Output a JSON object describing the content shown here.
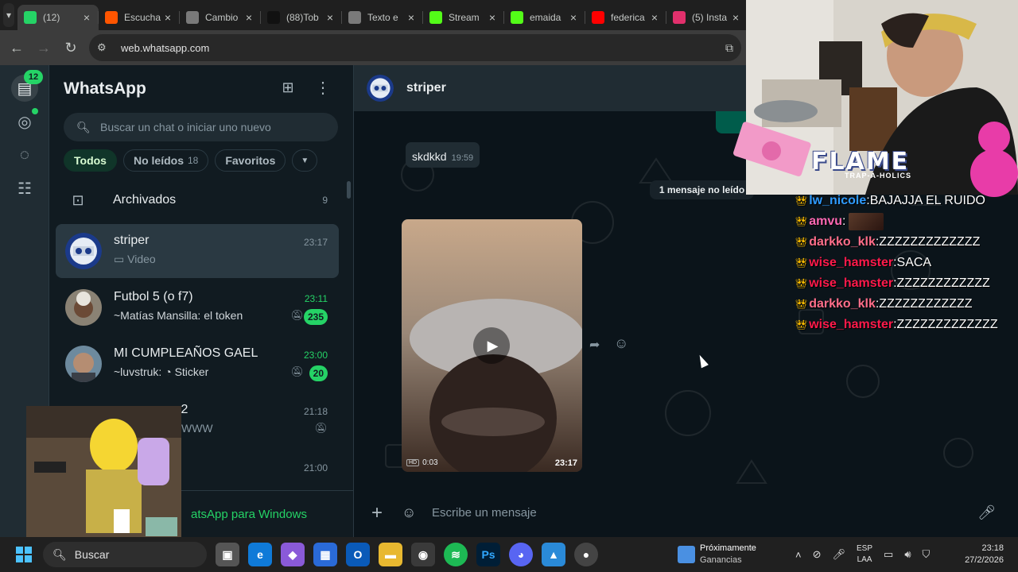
{
  "browser": {
    "tabs": [
      {
        "label": "(12)",
        "favicon_color": "#25d366",
        "active": true
      },
      {
        "label": "Escucha",
        "favicon_color": "#ff5500"
      },
      {
        "label": "Cambio",
        "favicon_color": "#7a7a7a"
      },
      {
        "label": "(88)Tob",
        "favicon_color": "#111111"
      },
      {
        "label": "Texto e",
        "favicon_color": "#7a7a7a"
      },
      {
        "label": "Stream",
        "favicon_color": "#53fc18"
      },
      {
        "label": "emaida",
        "favicon_color": "#53fc18"
      },
      {
        "label": "federica",
        "favicon_color": "#ff0000"
      },
      {
        "label": "(5) Insta",
        "favicon_color": "#e1306c"
      }
    ],
    "url": "web.whatsapp.com"
  },
  "rail": {
    "chats_badge": "12"
  },
  "chatlist": {
    "title": "WhatsApp",
    "search_placeholder": "Buscar un chat o iniciar uno nuevo",
    "filters": {
      "all": "Todos",
      "unread": "No leídos",
      "unread_count": "18",
      "favorites": "Favoritos"
    },
    "archived_label": "Archivados",
    "archived_count": "9",
    "chats": [
      {
        "name": "striper",
        "time": "23:17",
        "preview": "Video"
      },
      {
        "name": "Futbol 5 (o f7)",
        "time": "23:11",
        "preview": "~Matías Mansilla: el token",
        "badge": "235"
      },
      {
        "name": "MI CUMPLEAÑOS GAEL",
        "time": "23:00",
        "preview": "~luvstruk:",
        "preview_sticker": "Sticker",
        "badge": "20"
      },
      {
        "name": "x 2",
        "time": "21:18",
        "preview": "WWW"
      },
      {
        "name": "",
        "time": "21:00",
        "preview": ""
      }
    ],
    "footer": "atsApp para Windows"
  },
  "conversation": {
    "contact_name": "striper",
    "incoming_text": "skdkkd",
    "incoming_time": "19:59",
    "unread_divider": "1 mensaje no leído",
    "video_duration": "0:03",
    "video_hd": "HD",
    "video_time": "23:17",
    "composer_placeholder": "Escribe un mensaje"
  },
  "stream_chat": [
    {
      "user": "lw_nicole",
      "color": "#2f9bff",
      "message": "BAJAJJA EL RUIDO"
    },
    {
      "user": "amvu",
      "color": "#ff69b4",
      "message": ""
    },
    {
      "user": "darkko_klk",
      "color": "#ff6e8a",
      "message": "ZZZZZZZZZZZZZ"
    },
    {
      "user": "wise_hamster",
      "color": "#ff1a4b",
      "message": "SACA"
    },
    {
      "user": "wise_hamster",
      "color": "#ff1a4b",
      "message": "ZZZZZZZZZZZZ"
    },
    {
      "user": "darkko_klk",
      "color": "#ff6e8a",
      "message": "ZZZZZZZZZZZZ"
    },
    {
      "user": "wise_hamster",
      "color": "#ff1a4b",
      "message": "ZZZZZZZZZZZZZ"
    }
  ],
  "overlay": {
    "banner": "FLAME",
    "banner_sub": "TRAP-A-HOLICS"
  },
  "taskbar": {
    "search": "Buscar",
    "news_title": "Próximamente",
    "news_sub": "Ganancias",
    "lang_top": "ESP",
    "lang_bottom": "LAA",
    "time": "23:18",
    "date": "27/2/2026"
  }
}
